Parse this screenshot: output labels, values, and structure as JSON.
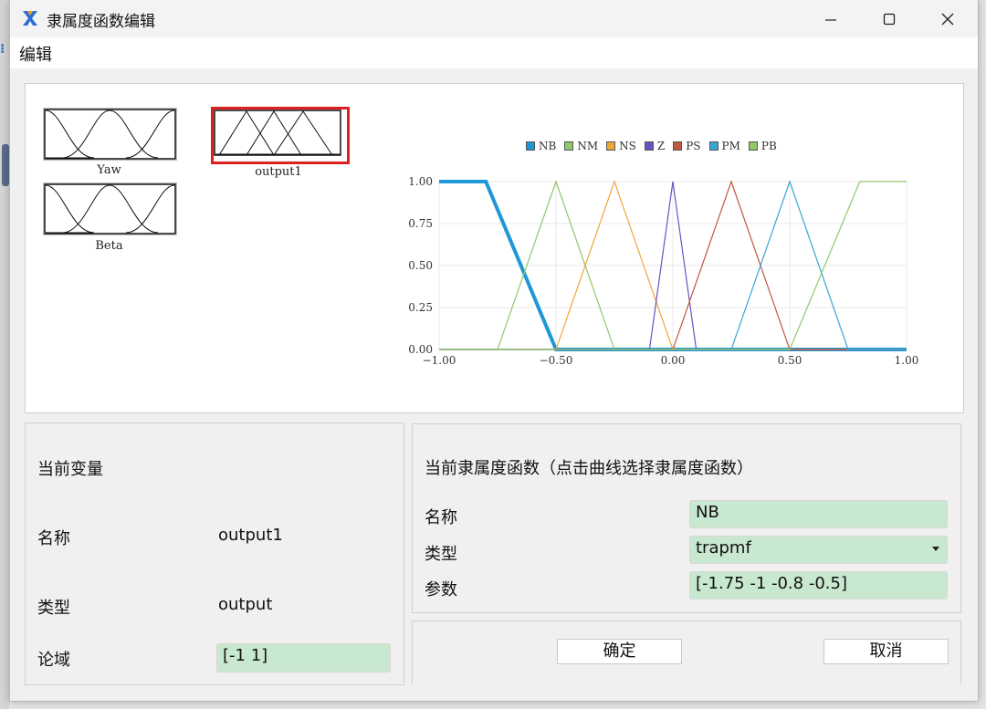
{
  "window": {
    "title": "隶属度函数编辑",
    "menu": [
      "编辑"
    ]
  },
  "variables": [
    {
      "label": "Yaw"
    },
    {
      "label": "Beta"
    },
    {
      "label": "output1",
      "selected": true
    }
  ],
  "chart_data": {
    "type": "line",
    "xlim": [
      -1,
      1
    ],
    "ylim": [
      0,
      1
    ],
    "xticks": [
      -1.0,
      -0.5,
      0.0,
      0.5,
      1.0
    ],
    "xtick_labels": [
      "−1.00",
      "−0.50",
      "0.00",
      "0.50",
      "1.00"
    ],
    "yticks": [
      0,
      0.25,
      0.5,
      0.75,
      1.0
    ],
    "ytick_labels": [
      "0.00",
      "0.25",
      "0.50",
      "0.75",
      "1.00"
    ],
    "grid": true,
    "legend_position": "top",
    "selected_series": "NB",
    "series": [
      {
        "name": "NB",
        "color": "#1f97d6",
        "x": [
          -1,
          -0.8,
          -0.5,
          1
        ],
        "y": [
          1,
          1,
          0,
          0
        ]
      },
      {
        "name": "NM",
        "color": "#91c86a",
        "x": [
          -1,
          -0.75,
          -0.5,
          -0.25,
          1
        ],
        "y": [
          0,
          0,
          1,
          0,
          0
        ]
      },
      {
        "name": "NS",
        "color": "#f0a73a",
        "x": [
          -1,
          -0.5,
          -0.25,
          0,
          1
        ],
        "y": [
          0,
          0,
          1,
          0,
          0
        ]
      },
      {
        "name": "Z",
        "color": "#6a52c4",
        "x": [
          -1,
          -0.1,
          0,
          0.1,
          1
        ],
        "y": [
          0,
          0,
          1,
          0,
          0
        ]
      },
      {
        "name": "PS",
        "color": "#c0583e",
        "x": [
          -1,
          0,
          0.25,
          0.5,
          1
        ],
        "y": [
          0,
          0,
          1,
          0,
          0
        ]
      },
      {
        "name": "PM",
        "color": "#39a6d8",
        "x": [
          -1,
          0.25,
          0.5,
          0.75,
          1
        ],
        "y": [
          0,
          0,
          1,
          0,
          0
        ]
      },
      {
        "name": "PB",
        "color": "#91c86a",
        "x": [
          -1,
          0.5,
          0.8,
          1
        ],
        "y": [
          0,
          0,
          1,
          1
        ]
      }
    ]
  },
  "current_variable": {
    "heading": "当前变量",
    "name_label": "名称",
    "name_value": "output1",
    "type_label": "类型",
    "type_value": "output",
    "range_label": "论域",
    "range_value": "[-1 1]"
  },
  "current_mf": {
    "heading": "当前隶属度函数（点击曲线选择隶属度函数）",
    "name_label": "名称",
    "name_value": "NB",
    "type_label": "类型",
    "type_value": "trapmf",
    "params_label": "参数",
    "params_value": "[-1.75 -1 -0.8 -0.5]"
  },
  "buttons": {
    "ok": "确定",
    "cancel": "取消"
  },
  "colors": {
    "field_bg": "#c9e8d0",
    "selected_border": "#e0201e"
  }
}
